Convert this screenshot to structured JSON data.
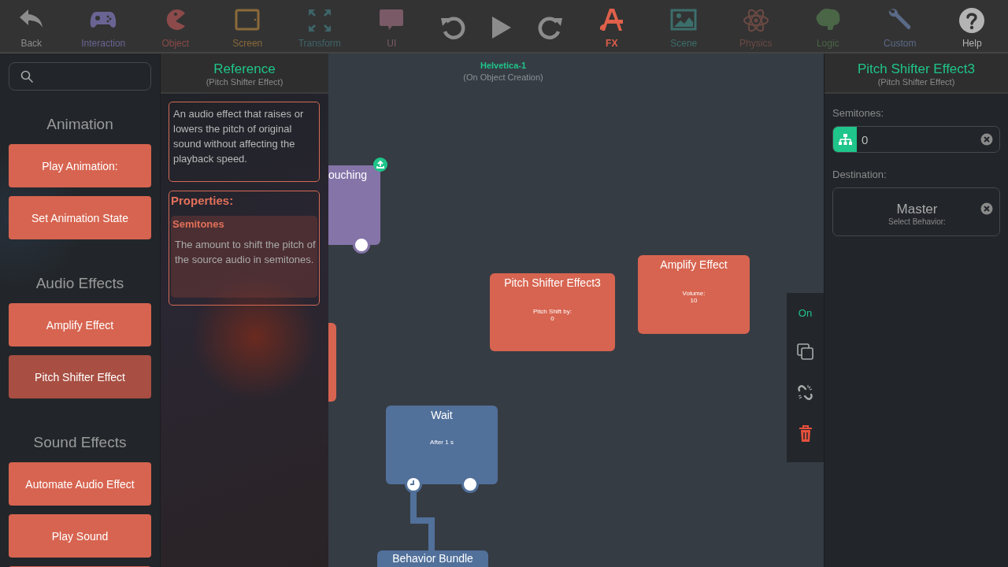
{
  "toolbar": {
    "left": [
      {
        "label": "Back",
        "color": "#8c8c8c",
        "selected": false
      },
      {
        "label": "Interaction",
        "color": "#6a6494",
        "selected": false
      },
      {
        "label": "Object",
        "color": "#8c4a4a",
        "selected": false
      },
      {
        "label": "Screen",
        "color": "#8a6a3a",
        "selected": false
      },
      {
        "label": "Transform",
        "color": "#3e6468",
        "selected": false
      },
      {
        "label": "UI",
        "color": "#7a5a66",
        "selected": false
      }
    ],
    "right": [
      {
        "label": "FX",
        "color": "#e0604a",
        "selected": true
      },
      {
        "label": "Scene",
        "color": "#3c6e6a",
        "selected": false
      },
      {
        "label": "Physics",
        "color": "#6b4a44",
        "selected": false
      },
      {
        "label": "Logic",
        "color": "#4a6646",
        "selected": false
      },
      {
        "label": "Custom",
        "color": "#5a6a88",
        "selected": false
      },
      {
        "label": "Help",
        "color": "#b4b4b4",
        "selected": false
      }
    ]
  },
  "sidebar": {
    "sections": [
      {
        "title": "Animation",
        "items": [
          {
            "label": "Play Animation:",
            "selected": false
          },
          {
            "label": "Set Animation State",
            "selected": false
          }
        ]
      },
      {
        "title": "Audio Effects",
        "items": [
          {
            "label": "Amplify Effect",
            "selected": false
          },
          {
            "label": "Pitch Shifter Effect",
            "selected": true
          }
        ]
      },
      {
        "title": "Sound Effects",
        "items": [
          {
            "label": "Automate Audio Effect",
            "selected": false
          },
          {
            "label": "Play Sound",
            "selected": false
          },
          {
            "selected": false
          }
        ]
      }
    ]
  },
  "reference": {
    "title": "Reference",
    "subtitle": "(Pitch Shifter Effect)",
    "description": "An audio effect that raises or lowers the pitch of original sound without affecting the playback speed.",
    "properties_title": "Properties:",
    "properties": [
      {
        "name": "Semitones",
        "description": "The amount to shift the pitch of the source audio in semitones."
      }
    ]
  },
  "canvas": {
    "object": "Helvetica-1",
    "event": "(On Object Creation)",
    "nodes": [
      {
        "kind": "event",
        "title": "ouching",
        "color": "#8474a8"
      },
      {
        "kind": "fragment",
        "color": "#d76450"
      },
      {
        "kind": "effect",
        "title": "Pitch Shifter Effect3",
        "param_label": "Pitch Shift by:",
        "param_value": "0",
        "color": "#d76450"
      },
      {
        "kind": "effect",
        "title": "Amplify Effect",
        "param_label": "Volume:",
        "param_value": "10",
        "color": "#d76450"
      },
      {
        "kind": "wait",
        "title": "Wait",
        "param_value": "After 1 s",
        "color": "#51709a"
      },
      {
        "kind": "bundle",
        "title": "Behavior Bundle",
        "color": "#51709a"
      }
    ],
    "tools": {
      "toggle_label": "On",
      "on": true
    }
  },
  "inspector": {
    "title": "Pitch Shifter Effect3",
    "subtitle": "(Pitch Shifter Effect)",
    "semitones": {
      "label": "Semitones:",
      "value": "0"
    },
    "destination": {
      "label": "Destination:",
      "value": "Master",
      "hint": "Select Behavior:"
    }
  }
}
